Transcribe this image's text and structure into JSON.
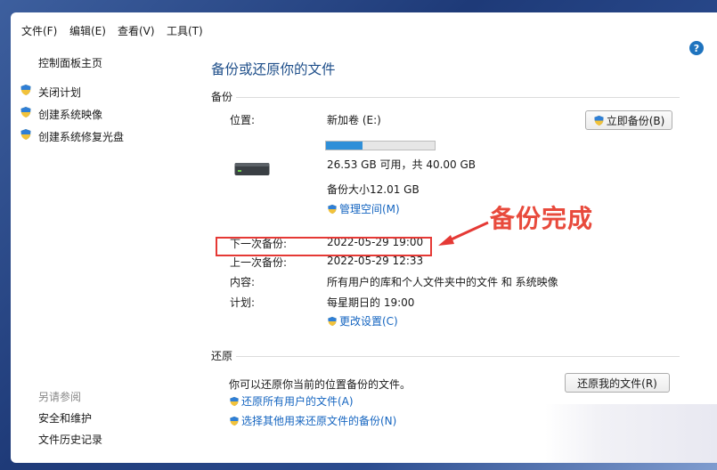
{
  "menu": {
    "file": "文件(F)",
    "edit": "编辑(E)",
    "view": "查看(V)",
    "tools": "工具(T)"
  },
  "sidebar": {
    "home": "控制面板主页",
    "items": [
      {
        "label": "关闭计划",
        "icon": "uac-shield-icon"
      },
      {
        "label": "创建系统映像",
        "icon": "uac-shield-icon"
      },
      {
        "label": "创建系统修复光盘",
        "icon": "uac-shield-icon"
      }
    ],
    "see_also_title": "另请参阅",
    "see_also": [
      "安全和维护",
      "文件历史记录"
    ]
  },
  "main": {
    "title": "备份或还原你的文件",
    "backup": {
      "section_label": "备份",
      "location_label": "位置:",
      "location_value": "新加卷 (E:)",
      "usage_fraction": 0.34,
      "space_text": "26.53 GB 可用，共 40.00 GB",
      "backup_size": "备份大小12.01 GB",
      "manage_space": "管理空间(M)",
      "backup_now_button": "立即备份(B)",
      "next_label": "下一次备份:",
      "next_value": "2022-05-29 19:00",
      "last_label": "上一次备份:",
      "last_value": "2022-05-29 12:33",
      "contents_label": "内容:",
      "contents_value": "所有用户的库和个人文件夹中的文件 和 系统映像",
      "schedule_label": "计划:",
      "schedule_value": "每星期日的 19:00",
      "change_settings": "更改设置(C)"
    },
    "restore": {
      "section_label": "还原",
      "description": "你可以还原你当前的位置备份的文件。",
      "restore_button": "还原我的文件(R)",
      "restore_all_users": "还原所有用户的文件(A)",
      "select_other": "选择其他用来还原文件的备份(N)"
    }
  },
  "annotation": {
    "text": "备份完成",
    "color": "#e53935"
  },
  "colors": {
    "title": "#1f4f8a",
    "link": "#1565c0",
    "progress": "#2f8fd8"
  }
}
